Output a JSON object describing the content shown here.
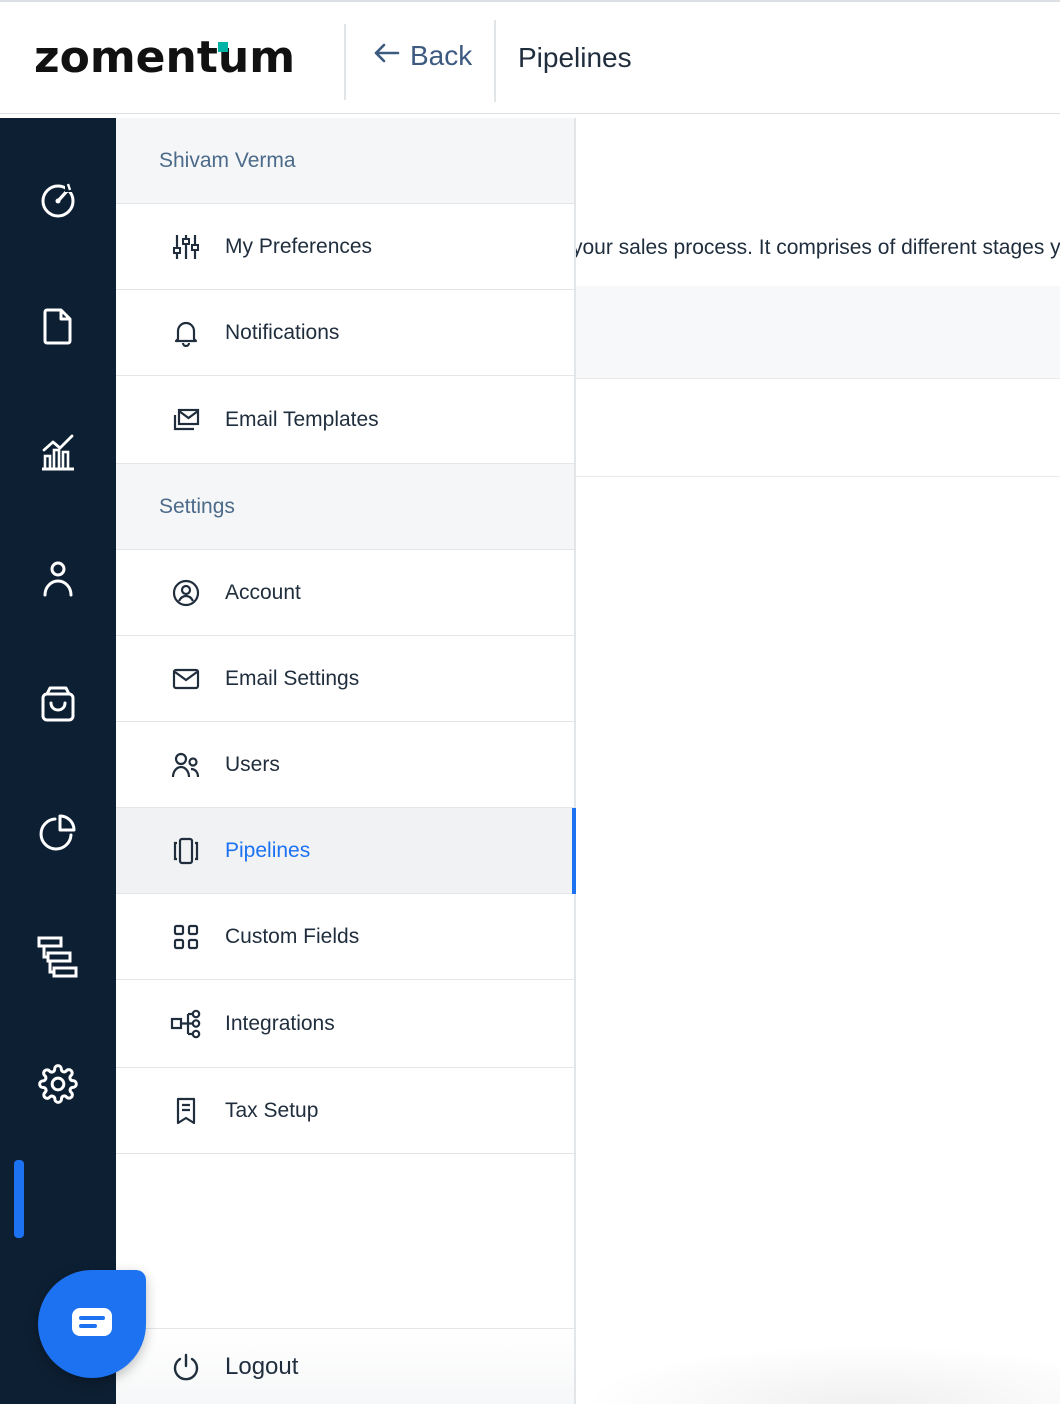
{
  "header": {
    "logo": "zomentum",
    "back_label": "Back",
    "breadcrumb": "Pipelines"
  },
  "rail": {
    "icons": [
      "dashboard-icon",
      "document-icon",
      "reports-icon",
      "contacts-icon",
      "marketplace-icon",
      "analytics-icon",
      "workflow-icon",
      "settings-icon"
    ],
    "active": "settings-icon"
  },
  "menu": {
    "user_section": "Shivam Verma",
    "user_items": [
      {
        "label": "My Preferences",
        "icon": "sliders-icon"
      },
      {
        "label": "Notifications",
        "icon": "bell-icon"
      },
      {
        "label": "Email Templates",
        "icon": "email-template-icon"
      }
    ],
    "settings_section": "Settings",
    "settings_items": [
      {
        "label": "Account",
        "icon": "account-icon"
      },
      {
        "label": "Email Settings",
        "icon": "envelope-icon"
      },
      {
        "label": "Users",
        "icon": "users-icon"
      },
      {
        "label": "Pipelines",
        "icon": "pipelines-icon"
      },
      {
        "label": "Custom Fields",
        "icon": "grid-icon"
      },
      {
        "label": "Integrations",
        "icon": "integrations-icon"
      },
      {
        "label": "Tax Setup",
        "icon": "receipt-icon"
      }
    ],
    "active_item": "Pipelines",
    "logout_label": "Logout"
  },
  "content": {
    "description": "your sales process. It comprises of different stages your"
  },
  "colors": {
    "accent": "#1d72f2",
    "rail": "#0d1f33",
    "logo_accent": "#00b3a4"
  }
}
